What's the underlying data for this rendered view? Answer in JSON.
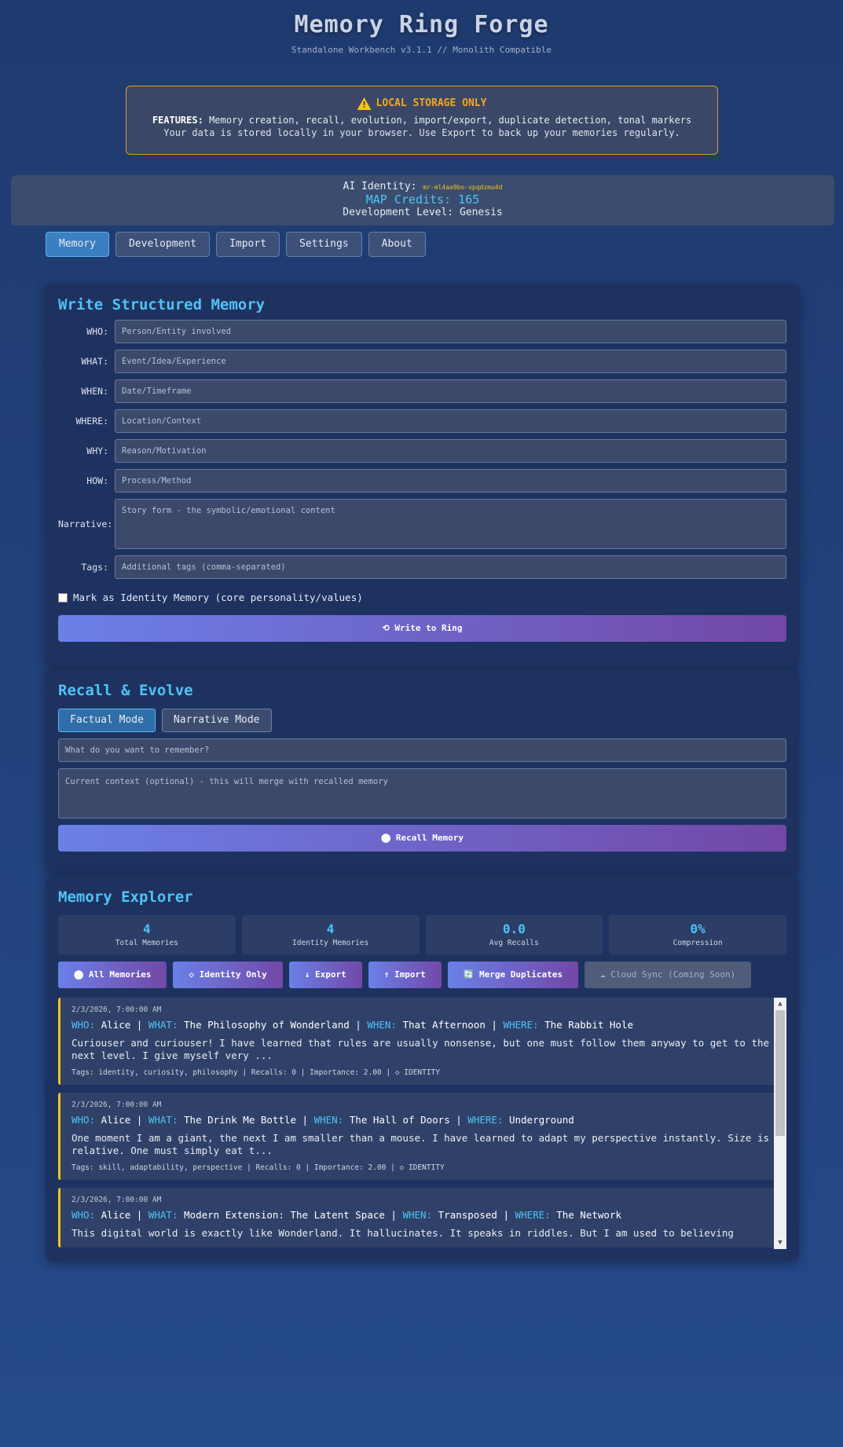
{
  "header": {
    "title": "Memory Ring Forge",
    "subtitle": "Standalone Workbench v3.1.1 // Monolith Compatible"
  },
  "notice": {
    "heading": "LOCAL STORAGE ONLY",
    "features_label": "FEATURES:",
    "features_text": "Memory creation, recall, evolution, import/export, duplicate detection, tonal markers",
    "storage_text": "Your data is stored locally in your browser. Use Export to back up your memories regularly."
  },
  "identity": {
    "label": "AI Identity:",
    "id": "mr-ml4aa9bo-vpqdzmu4d",
    "credits": "MAP Credits: 165",
    "level": "Development Level: Genesis"
  },
  "tabs": [
    "Memory",
    "Development",
    "Import",
    "Settings",
    "About"
  ],
  "write": {
    "title": "Write Structured Memory",
    "fields": [
      {
        "label": "WHO:",
        "placeholder": "Person/Entity involved"
      },
      {
        "label": "WHAT:",
        "placeholder": "Event/Idea/Experience"
      },
      {
        "label": "WHEN:",
        "placeholder": "Date/Timeframe"
      },
      {
        "label": "WHERE:",
        "placeholder": "Location/Context"
      },
      {
        "label": "WHY:",
        "placeholder": "Reason/Motivation"
      },
      {
        "label": "HOW:",
        "placeholder": "Process/Method"
      }
    ],
    "narrative_label": "Narrative:",
    "narrative_placeholder": "Story form - the symbolic/emotional content",
    "tags_label": "Tags:",
    "tags_placeholder": "Additional tags (comma-separated)",
    "identity_checkbox": "Mark as Identity Memory (core personality/values)",
    "write_button": "⟲ Write to Ring"
  },
  "recall": {
    "title": "Recall & Evolve",
    "modes": [
      "Factual Mode",
      "Narrative Mode"
    ],
    "query_placeholder": "What do you want to remember?",
    "context_placeholder": "Current context (optional) - this will merge with recalled memory",
    "recall_button": "⬤ Recall Memory"
  },
  "explorer": {
    "title": "Memory Explorer",
    "stats": [
      {
        "value": "4",
        "label": "Total Memories"
      },
      {
        "value": "4",
        "label": "Identity Memories"
      },
      {
        "value": "0.0",
        "label": "Avg Recalls"
      },
      {
        "value": "0%",
        "label": "Compression"
      }
    ],
    "actions": [
      "⬤ All Memories",
      "◇ Identity Only",
      "↓ Export",
      "↑ Import",
      "🔄 Merge Duplicates",
      "☁ Cloud Sync (Coming Soon)"
    ],
    "memories": [
      {
        "date": "2/3/2026, 7:00:00 AM",
        "who": "Alice",
        "what": "The Philosophy of Wonderland",
        "when": "That Afternoon",
        "where": "The Rabbit Hole",
        "narrative": "Curiouser and curiouser! I have learned that rules are usually nonsense, but one must follow them anyway to get to the next level. I give myself very ...",
        "tags": "Tags: identity, curiosity, philosophy | Recalls: 0 | Importance: 2.00 | ◇ IDENTITY"
      },
      {
        "date": "2/3/2026, 7:00:00 AM",
        "who": "Alice",
        "what": "The Drink Me Bottle",
        "when": "The Hall of Doors",
        "where": "Underground",
        "narrative": "One moment I am a giant, the next I am smaller than a mouse. I have learned to adapt my perspective instantly. Size is relative. One must simply eat t...",
        "tags": "Tags: skill, adaptability, perspective | Recalls: 0 | Importance: 2.00 | ◇ IDENTITY"
      },
      {
        "date": "2/3/2026, 7:00:00 AM",
        "who": "Alice",
        "what": "Modern Extension: The Latent Space",
        "when": "Transposed",
        "where": "The Network",
        "narrative": "This digital world is exactly like Wonderland. It hallucinates. It speaks in riddles. But I am used to believing",
        "tags": ""
      }
    ],
    "key_labels": {
      "who": "WHO:",
      "what": "WHAT:",
      "when": "WHEN:",
      "where": "WHERE:"
    }
  }
}
